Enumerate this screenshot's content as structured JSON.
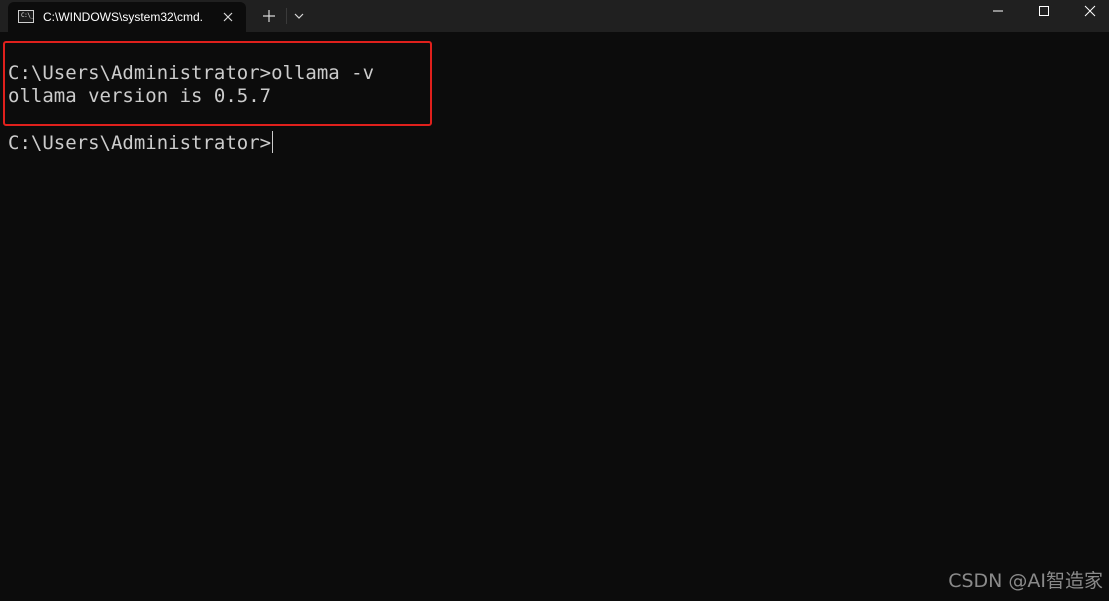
{
  "window": {
    "tab_title": "C:\\WINDOWS\\system32\\cmd.",
    "tab_icon": "cmd-console-icon",
    "tab_icon_glyph": "C:\\_",
    "controls": {
      "new_tab": "plus-icon",
      "dropdown": "chevron-down-icon",
      "minimize": "minimize-icon",
      "maximize": "maximize-icon",
      "close": "close-icon"
    }
  },
  "terminal": {
    "lines": [
      "C:\\Users\\Administrator>ollama -v",
      "ollama version is 0.5.7",
      "C:\\Users\\Administrator>"
    ],
    "highlight_color": "#e0201c",
    "text_color": "#cccccc",
    "background_color": "#0c0c0c"
  },
  "watermark": {
    "text": "CSDN @AI智造家"
  }
}
